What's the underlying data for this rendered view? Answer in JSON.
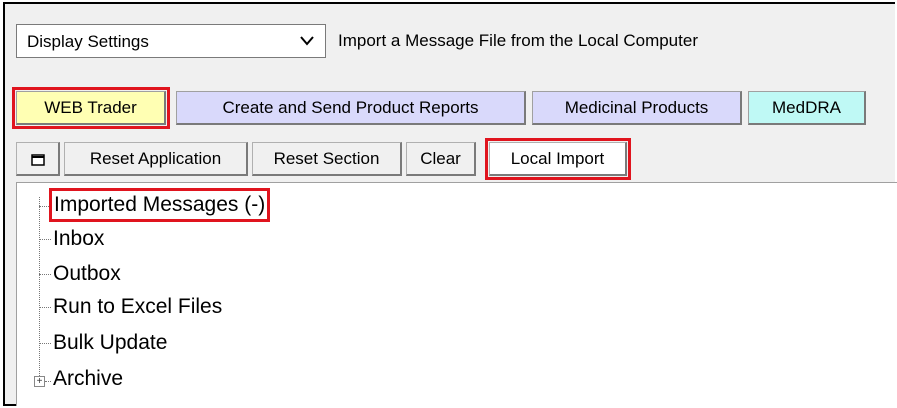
{
  "display_select": {
    "value": "Display Settings",
    "caption": "Import a Message File from the Local Computer"
  },
  "tabs": [
    {
      "label": "WEB Trader",
      "color": "#ffffb3"
    },
    {
      "label": "Create and Send Product Reports",
      "color": "#d9d9fb"
    },
    {
      "label": "Medicinal Products",
      "color": "#d9d9fb"
    },
    {
      "label": "MedDRA",
      "color": "#bff9f5"
    }
  ],
  "toolbar": {
    "reset_application": "Reset Application",
    "reset_section": "Reset Section",
    "clear": "Clear",
    "local_import": "Local Import"
  },
  "tree": {
    "items": [
      {
        "label": "Imported Messages (-)"
      },
      {
        "label": "Inbox"
      },
      {
        "label": "Outbox"
      },
      {
        "label": "Run to Excel Files"
      },
      {
        "label": "Bulk Update"
      },
      {
        "label": "Archive",
        "expandable": true
      }
    ]
  },
  "highlight_color": "#e0141e"
}
